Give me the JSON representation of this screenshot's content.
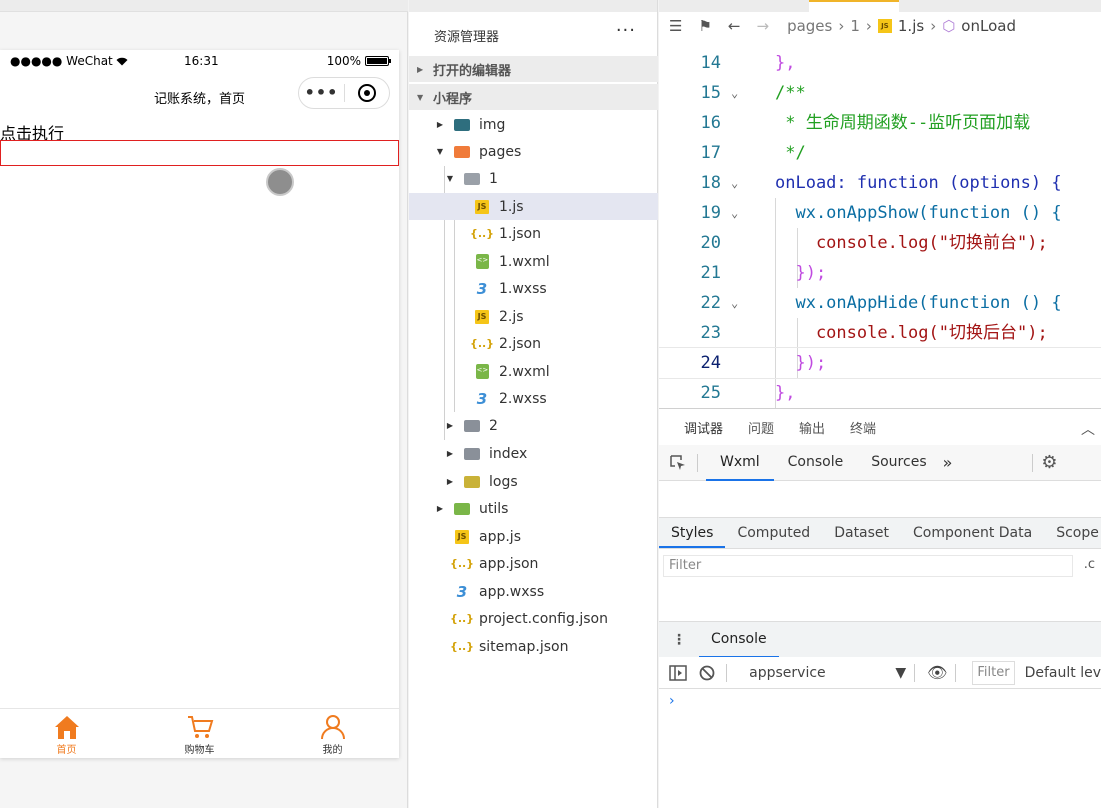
{
  "simulator": {
    "status": {
      "carrier": "●●●●● WeChat",
      "time": "16:31",
      "battery": "100%"
    },
    "nav_title": "记账系统，首页",
    "page_text": "点击执行",
    "tabbar": [
      {
        "label": "首页",
        "icon": "home-icon"
      },
      {
        "label": "购物车",
        "icon": "cart-icon"
      },
      {
        "label": "我的",
        "icon": "user-icon"
      }
    ],
    "accent_color": "#f07b1f"
  },
  "explorer": {
    "title": "资源管理器",
    "more": "···",
    "open_editors": "打开的编辑器",
    "project": "小程序",
    "tree": [
      {
        "label": "img",
        "type": "folder-teal"
      },
      {
        "label": "pages",
        "type": "folder-orange"
      },
      {
        "label": "1",
        "type": "folder-open"
      },
      {
        "label": "1.js",
        "type": "js"
      },
      {
        "label": "1.json",
        "type": "json"
      },
      {
        "label": "1.wxml",
        "type": "wxml"
      },
      {
        "label": "1.wxss",
        "type": "wxss"
      },
      {
        "label": "2.js",
        "type": "js"
      },
      {
        "label": "2.json",
        "type": "json"
      },
      {
        "label": "2.wxml",
        "type": "wxml"
      },
      {
        "label": "2.wxss",
        "type": "wxss"
      },
      {
        "label": "2",
        "type": "folder"
      },
      {
        "label": "index",
        "type": "folder"
      },
      {
        "label": "logs",
        "type": "folder-yellow"
      },
      {
        "label": "utils",
        "type": "folder-green"
      },
      {
        "label": "app.js",
        "type": "js"
      },
      {
        "label": "app.json",
        "type": "json"
      },
      {
        "label": "app.wxss",
        "type": "wxss"
      },
      {
        "label": "project.config.json",
        "type": "json"
      },
      {
        "label": "sitemap.json",
        "type": "json"
      }
    ]
  },
  "editor": {
    "breadcrumb": {
      "seg1": "pages",
      "seg2": "1",
      "file": "1.js",
      "symbol": "onLoad"
    },
    "lines": [
      {
        "no": "14",
        "text": "},",
        "cls": "c-punc",
        "fold": ""
      },
      {
        "no": "15",
        "text": "/**",
        "cls": "c-com",
        "fold": "⌄"
      },
      {
        "no": "16",
        "text": " * 生命周期函数--监听页面加载",
        "cls": "c-com",
        "fold": ""
      },
      {
        "no": "17",
        "text": " */",
        "cls": "c-com",
        "fold": ""
      },
      {
        "no": "18",
        "text": "onLoad: function (options) {",
        "cls": "mixed-onload",
        "fold": "⌄"
      },
      {
        "no": "19",
        "text": "  wx.onAppShow(function () {",
        "cls": "mixed-show",
        "fold": "⌄"
      },
      {
        "no": "20",
        "text": "    console.log(\"切换前台\");",
        "cls": "mixed-log1",
        "fold": ""
      },
      {
        "no": "21",
        "text": "  });",
        "cls": "c-paren",
        "fold": ""
      },
      {
        "no": "22",
        "text": "  wx.onAppHide(function () {",
        "cls": "mixed-hide",
        "fold": "⌄"
      },
      {
        "no": "23",
        "text": "    console.log(\"切换后台\");",
        "cls": "mixed-log2",
        "fold": ""
      },
      {
        "no": "24",
        "text": "  });",
        "cls": "c-paren",
        "fold": ""
      },
      {
        "no": "25",
        "text": "},",
        "cls": "c-punc",
        "fold": ""
      }
    ],
    "current_line": "24"
  },
  "debugger": {
    "panel_tabs": [
      "调试器",
      "问题",
      "输出",
      "终端"
    ],
    "devtools_tabs": [
      "Wxml",
      "Console",
      "Sources"
    ],
    "devtools_more": "»",
    "style_tabs": [
      "Styles",
      "Computed",
      "Dataset",
      "Component Data",
      "Scope Da"
    ],
    "filter_placeholder": "Filter",
    "filter_more": ".c",
    "console_tab": "Console",
    "context": "appservice",
    "console_filter": "Filter",
    "levels": "Default lev",
    "prompt": "›"
  }
}
